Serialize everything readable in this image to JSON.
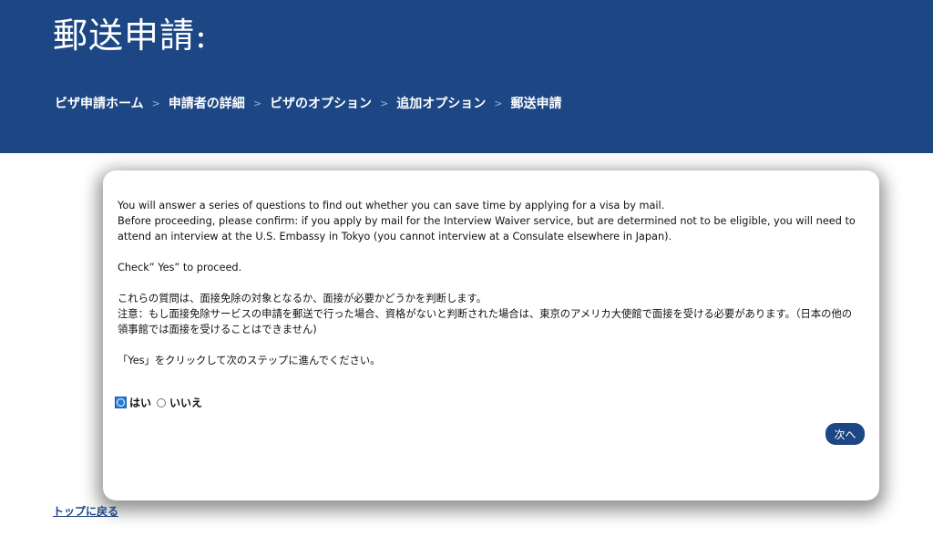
{
  "header": {
    "title": "郵送申請:",
    "breadcrumb": [
      {
        "label": "ビザ申請ホーム"
      },
      {
        "label": "申請者の詳細"
      },
      {
        "label": "ビザのオプション"
      },
      {
        "label": "追加オプション"
      },
      {
        "label": "郵送申請"
      }
    ],
    "separator": ">"
  },
  "card": {
    "intro_line1": "You will answer a series of questions to find out whether you can save time by applying for a visa by mail.",
    "intro_line2": "Before proceeding, please confirm: if you apply by mail for the Interview Waiver service, but are determined not to be eligible, you will need to attend an interview at the U.S. Embassy in Tokyo (you cannot interview at a Consulate elsewhere in Japan).",
    "check_yes": "Check” Yes” to proceed.",
    "jp_line1": "これらの質問は、面接免除の対象となるか、面接が必要かどうかを判断します。",
    "jp_line2": "注意：もし面接免除サービスの申請を郵送で行った場合、資格がないと判断された場合は、東京のアメリカ大使館で面接を受ける必要があります。（日本の他の領事館では面接を受けることはできません)",
    "jp_click": "「Yes」をクリックして次のステップに進んでください。",
    "radio_yes": "はい",
    "radio_no": "いいえ",
    "selected": "はい",
    "next_button": "次へ"
  },
  "footer": {
    "back_to_top": "トップに戻る"
  },
  "colors": {
    "header_bg": "#1c4684",
    "button_bg": "#1c4684",
    "radio_selected": "#2b7bd6"
  }
}
